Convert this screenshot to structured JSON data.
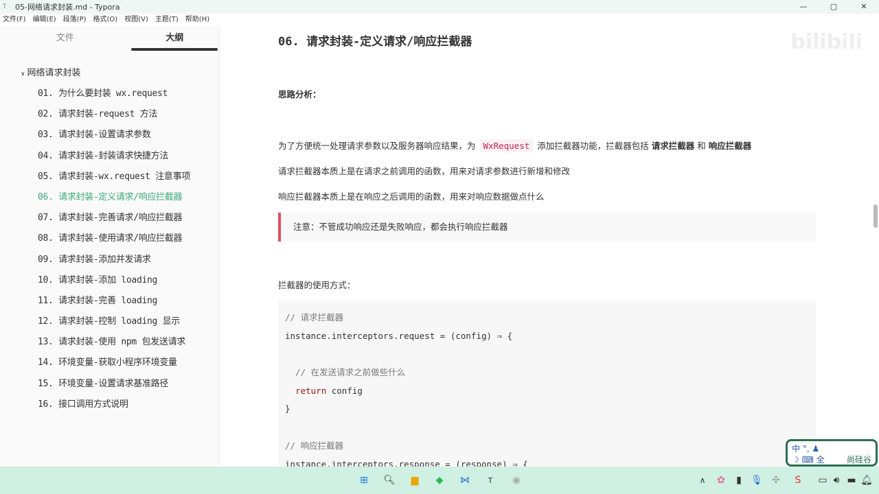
{
  "window": {
    "title": "05-网络请求封装.md - Typora",
    "app_icon": "T"
  },
  "menu": [
    "文件(F)",
    "编辑(E)",
    "段落(P)",
    "格式(O)",
    "视图(V)",
    "主题(T)",
    "帮助(H)"
  ],
  "sidebar": {
    "tabs": [
      "文件",
      "大纲"
    ],
    "root": "网络请求封装",
    "items": [
      "01. 为什么要封装 wx.request",
      "02. 请求封装-request 方法",
      "03. 请求封装-设置请求参数",
      "04. 请求封装-封装请求快捷方法",
      "05. 请求封装-wx.request 注意事项",
      "06. 请求封装-定义请求/响应拦截器",
      "07. 请求封装-完善请求/响应拦截器",
      "08. 请求封装-使用请求/响应拦截器",
      "09. 请求封装-添加并发请求",
      "10. 请求封装-添加 loading",
      "11. 请求封装-完善 loading",
      "12. 请求封装-控制 loading 显示",
      "13. 请求封装-使用 npm 包发送请求",
      "14. 环境变量-获取小程序环境变量",
      "15. 环境变量-设置请求基准路径",
      "16. 接口调用方式说明"
    ],
    "active_index": 5,
    "footer": [
      "<",
      "</>"
    ]
  },
  "doc": {
    "heading": "06. 请求封装-定义请求/响应拦截器",
    "analysis": "思路分析：",
    "p1a": "为了方便统一处理请求参数以及服务器响应结果，为",
    "p1code": "WxRequest",
    "p1b": "添加拦截器功能，拦截器包括",
    "p1bold1": "请求拦截器",
    "p1and": "和",
    "p1bold2": "响应拦截器",
    "p2": "请求拦截器本质上是在请求之前调用的函数，用来对请求参数进行新增和修改",
    "p3": "响应拦截器本质上是在响应之后调用的函数，用来对响应数据做点什么",
    "quote": "注意：不管成功响应还是失败响应，都会执行响应拦截器",
    "usage": "拦截器的使用方式：",
    "code": [
      "// 请求拦截器",
      "instance.interceptors.request = (config) ⇒ {",
      "",
      "  // 在发送请求之前做些什么",
      "  return config",
      "}",
      "",
      "// 响应拦截器",
      "instance.interceptors.response = (response) ⇒ {"
    ]
  },
  "watermark": "bilibili",
  "ime": {
    "line1": "中 °, ♟",
    "line2": "☽ ⌨ 全",
    "brand": "尚硅谷"
  }
}
